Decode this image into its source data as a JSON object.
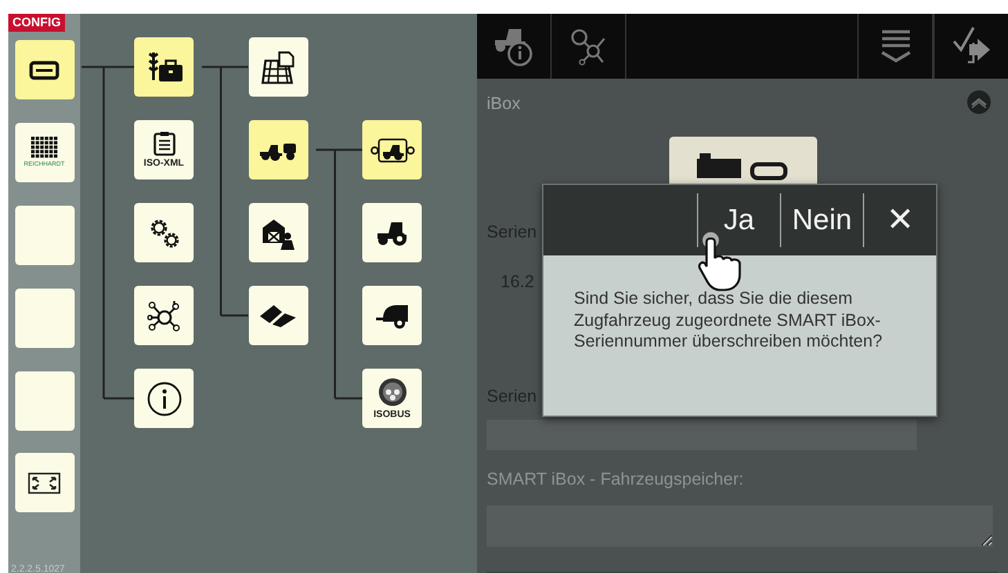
{
  "config_badge": "CONFIG",
  "sidebar": [
    {
      "kind": "terminal",
      "selected": true
    },
    {
      "kind": "keypad",
      "label": "REICHHARDT",
      "selected": false
    },
    {
      "kind": "blank",
      "selected": false
    },
    {
      "kind": "blank",
      "selected": false
    },
    {
      "kind": "blank",
      "selected": false
    },
    {
      "kind": "fullscreen",
      "selected": false
    }
  ],
  "version": "2.2.2.5.1027",
  "tree": [
    {
      "kind": "farm-business",
      "selected": true,
      "children": [
        {
          "kind": "field-map",
          "selected": false
        },
        {
          "kind": "tractor-trailer",
          "selected": true,
          "children": [
            {
              "kind": "tractor-implement",
              "selected": true
            },
            {
              "kind": "tractor",
              "selected": false
            },
            {
              "kind": "trailer",
              "selected": false
            },
            {
              "kind": "isobus",
              "label": "ISOBUS",
              "selected": false
            }
          ]
        },
        {
          "kind": "barn-person",
          "selected": false
        },
        {
          "kind": "fields",
          "selected": false
        }
      ]
    },
    {
      "kind": "iso-xml",
      "label": "ISO-XML",
      "selected": false
    },
    {
      "kind": "gears",
      "selected": false
    },
    {
      "kind": "network",
      "selected": false
    },
    {
      "kind": "info",
      "selected": false
    }
  ],
  "toolbar": [
    {
      "kind": "tractor-info"
    },
    {
      "kind": "network"
    },
    {
      "kind": "spacer"
    },
    {
      "kind": "menu"
    },
    {
      "kind": "exit"
    }
  ],
  "panel": {
    "title": "iBox",
    "serial_label": "Serien",
    "serial_value": "16.2",
    "serial_label_2": "Serien",
    "memory_label": "SMART iBox - Fahrzeugspeicher:"
  },
  "dialog": {
    "buttons": [
      {
        "kind": "text",
        "label": "Ja"
      },
      {
        "kind": "text",
        "label": "Nein"
      },
      {
        "kind": "close",
        "label": "✕"
      }
    ],
    "message": "Sind Sie sicher, dass Sie die diesem Zugfahrzeug zugeordnete SMART iBox-Seriennummer überschreiben möchten?"
  }
}
